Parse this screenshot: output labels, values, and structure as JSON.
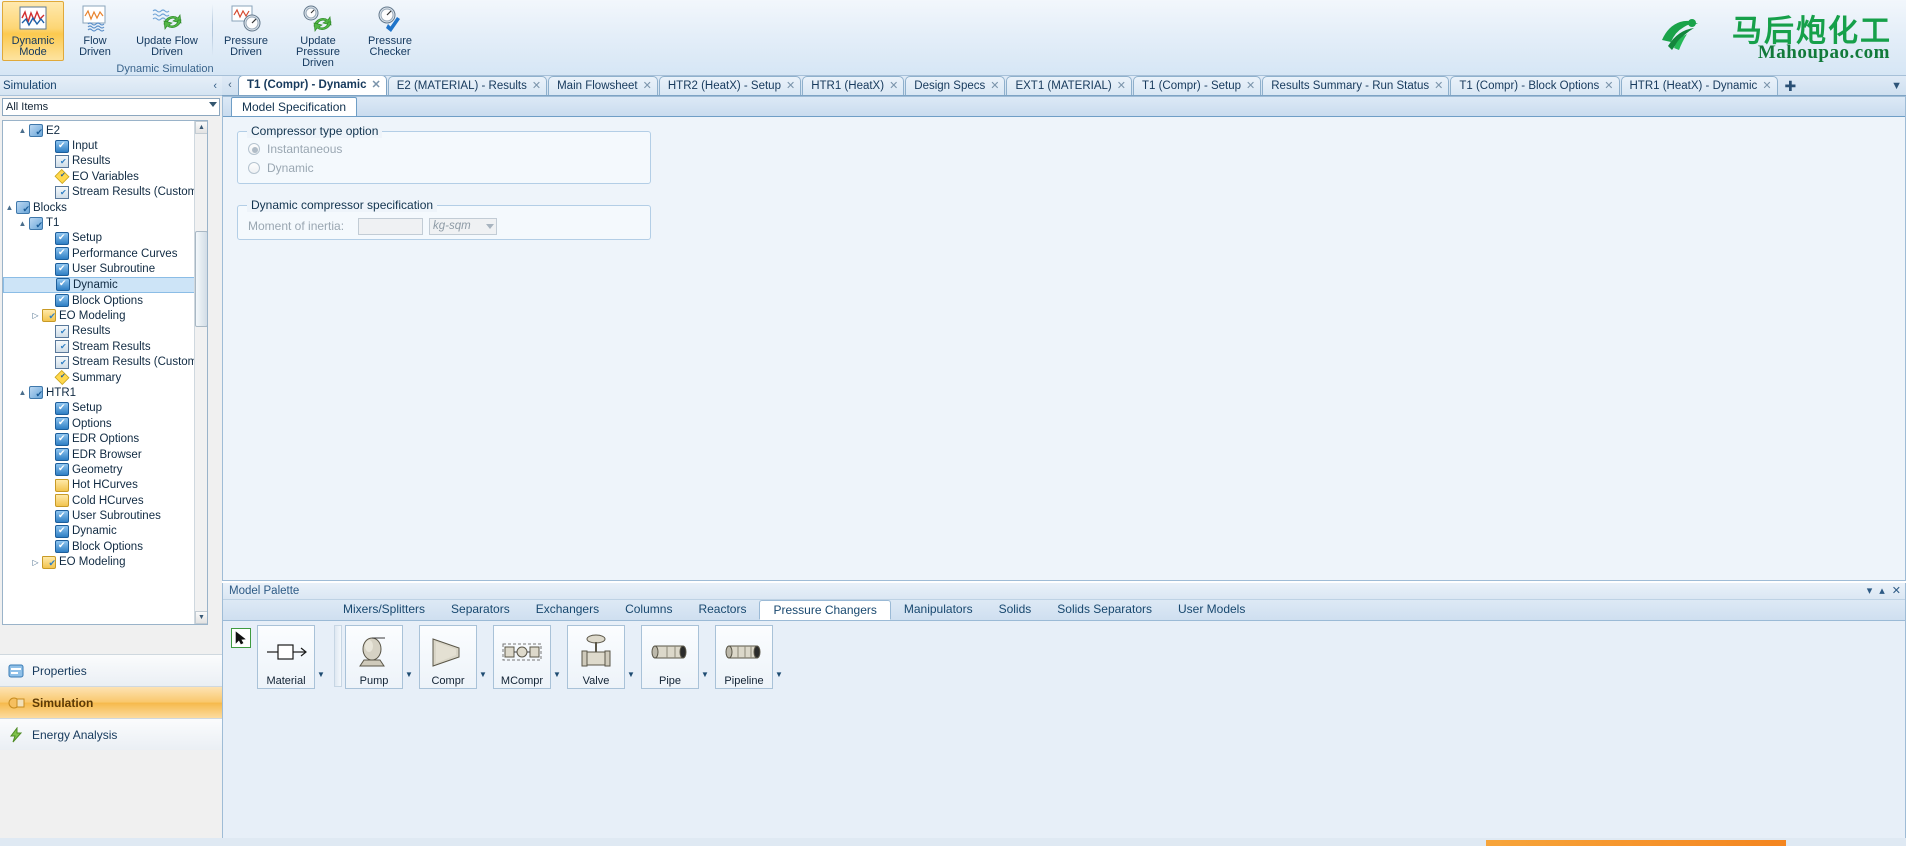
{
  "ribbon": {
    "buttons": [
      {
        "label": "Dynamic\nMode",
        "icon": "dynamic-mode-icon",
        "selected": true
      },
      {
        "label": "Flow\nDriven",
        "icon": "flow-driven-icon",
        "selected": false
      },
      {
        "label": "Update Flow\nDriven",
        "icon": "update-flow-driven-icon",
        "selected": false
      },
      {
        "label": "Pressure\nDriven",
        "icon": "pressure-driven-icon",
        "selected": false
      },
      {
        "label": "Update Pressure\nDriven",
        "icon": "update-pressure-driven-icon",
        "selected": false
      },
      {
        "label": "Pressure\nChecker",
        "icon": "pressure-checker-icon",
        "selected": false
      }
    ],
    "group_label": "Dynamic Simulation"
  },
  "logo": {
    "chinese": "马后炮化工",
    "english": "Mahoupao.com"
  },
  "doc_tabs": [
    {
      "label": "T1 (Compr) - Dynamic",
      "active": true
    },
    {
      "label": "E2 (MATERIAL) - Results",
      "active": false
    },
    {
      "label": "Main Flowsheet",
      "active": false
    },
    {
      "label": "HTR2 (HeatX) - Setup",
      "active": false
    },
    {
      "label": "HTR1 (HeatX)",
      "active": false
    },
    {
      "label": "Design Specs",
      "active": false
    },
    {
      "label": "EXT1 (MATERIAL)",
      "active": false
    },
    {
      "label": "T1 (Compr) - Setup",
      "active": false
    },
    {
      "label": "Results Summary - Run Status",
      "active": false
    },
    {
      "label": "T1 (Compr) - Block Options",
      "active": false
    },
    {
      "label": "HTR1 (HeatX) - Dynamic",
      "active": false
    }
  ],
  "tab_close_glyph": "✕",
  "tab_add_glyph": "✚",
  "tab_prev_glyph": "‹",
  "tab_dropdown_glyph": "▼",
  "sidebar": {
    "title": "Simulation",
    "collapse_glyph": "‹",
    "filter_value": "All Items",
    "tree": [
      {
        "label": "E2",
        "indent": 1,
        "icon": "blocks-icon",
        "twisty": "▲",
        "selected": false
      },
      {
        "label": "Input",
        "indent": 3,
        "icon": "form-icon",
        "twisty": "",
        "selected": false
      },
      {
        "label": "Results",
        "indent": 3,
        "icon": "sheet-icon",
        "twisty": "",
        "selected": false
      },
      {
        "label": "EO Variables",
        "indent": 3,
        "icon": "diamond-icon",
        "twisty": "",
        "selected": false
      },
      {
        "label": "Stream Results (Custom)",
        "indent": 3,
        "icon": "sheet-icon",
        "twisty": "",
        "selected": false
      },
      {
        "label": "Blocks",
        "indent": 0,
        "icon": "blocks-icon",
        "twisty": "▲",
        "selected": false
      },
      {
        "label": "T1",
        "indent": 1,
        "icon": "blocks-icon",
        "twisty": "▲",
        "selected": false
      },
      {
        "label": "Setup",
        "indent": 3,
        "icon": "form-icon",
        "twisty": "",
        "selected": false
      },
      {
        "label": "Performance Curves",
        "indent": 3,
        "icon": "form-icon",
        "twisty": "",
        "selected": false
      },
      {
        "label": "User Subroutine",
        "indent": 3,
        "icon": "form-icon",
        "twisty": "",
        "selected": false
      },
      {
        "label": "Dynamic",
        "indent": 3,
        "icon": "form-icon",
        "twisty": "",
        "selected": true
      },
      {
        "label": "Block Options",
        "indent": 3,
        "icon": "form-icon",
        "twisty": "",
        "selected": false
      },
      {
        "label": "EO Modeling",
        "indent": 2,
        "icon": "folder-chk-icon",
        "twisty": "▷",
        "selected": false
      },
      {
        "label": "Results",
        "indent": 3,
        "icon": "sheet-icon",
        "twisty": "",
        "selected": false
      },
      {
        "label": "Stream Results",
        "indent": 3,
        "icon": "sheet-icon",
        "twisty": "",
        "selected": false
      },
      {
        "label": "Stream Results (Custom)",
        "indent": 3,
        "icon": "sheet-icon",
        "twisty": "",
        "selected": false
      },
      {
        "label": "Summary",
        "indent": 3,
        "icon": "diamond-icon",
        "twisty": "",
        "selected": false
      },
      {
        "label": "HTR1",
        "indent": 1,
        "icon": "blocks-icon",
        "twisty": "▲",
        "selected": false
      },
      {
        "label": "Setup",
        "indent": 3,
        "icon": "form-icon",
        "twisty": "",
        "selected": false
      },
      {
        "label": "Options",
        "indent": 3,
        "icon": "form-icon",
        "twisty": "",
        "selected": false
      },
      {
        "label": "EDR Options",
        "indent": 3,
        "icon": "form-icon",
        "twisty": "",
        "selected": false
      },
      {
        "label": "EDR Browser",
        "indent": 3,
        "icon": "form-icon",
        "twisty": "",
        "selected": false
      },
      {
        "label": "Geometry",
        "indent": 3,
        "icon": "form-icon",
        "twisty": "",
        "selected": false
      },
      {
        "label": "Hot HCurves",
        "indent": 3,
        "icon": "folder-icon",
        "twisty": "",
        "selected": false
      },
      {
        "label": "Cold HCurves",
        "indent": 3,
        "icon": "folder-icon",
        "twisty": "",
        "selected": false
      },
      {
        "label": "User Subroutines",
        "indent": 3,
        "icon": "form-icon",
        "twisty": "",
        "selected": false
      },
      {
        "label": "Dynamic",
        "indent": 3,
        "icon": "form-icon",
        "twisty": "",
        "selected": false
      },
      {
        "label": "Block Options",
        "indent": 3,
        "icon": "form-icon",
        "twisty": "",
        "selected": false
      },
      {
        "label": "EO Modeling",
        "indent": 2,
        "icon": "folder-chk-icon",
        "twisty": "▷",
        "selected": false
      }
    ],
    "nav_buttons": [
      {
        "label": "Properties",
        "icon": "properties-icon",
        "active": false
      },
      {
        "label": "Simulation",
        "icon": "simulation-icon",
        "active": true
      },
      {
        "label": "Energy Analysis",
        "icon": "energy-analysis-icon",
        "active": false
      }
    ]
  },
  "main": {
    "inner_tabs": [
      {
        "label": "Model Specification",
        "active": true
      }
    ],
    "compressor_group": {
      "title": "Compressor type option",
      "options": [
        {
          "label": "Instantaneous",
          "checked": true
        },
        {
          "label": "Dynamic",
          "checked": false
        }
      ]
    },
    "dynamic_group": {
      "title": "Dynamic compressor specification",
      "field_label": "Moment of inertia:",
      "field_value": "",
      "units_value": "kg-sqm"
    }
  },
  "palette": {
    "title": "Model Palette",
    "win_buttons": [
      "▾",
      "▴",
      "✕"
    ],
    "tabs": [
      {
        "label": "Mixers/Splitters",
        "active": false
      },
      {
        "label": "Separators",
        "active": false
      },
      {
        "label": "Exchangers",
        "active": false
      },
      {
        "label": "Columns",
        "active": false
      },
      {
        "label": "Reactors",
        "active": false
      },
      {
        "label": "Pressure Changers",
        "active": true
      },
      {
        "label": "Manipulators",
        "active": false
      },
      {
        "label": "Solids",
        "active": false
      },
      {
        "label": "Solids Separators",
        "active": false
      },
      {
        "label": "User Models",
        "active": false
      }
    ],
    "pointer_tool": "▲",
    "items": [
      {
        "label": "Material",
        "icon": "material-stream-icon"
      },
      {
        "label": "Pump",
        "icon": "pump-icon"
      },
      {
        "label": "Compr",
        "icon": "compressor-icon"
      },
      {
        "label": "MCompr",
        "icon": "multistage-compressor-icon"
      },
      {
        "label": "Valve",
        "icon": "valve-icon"
      },
      {
        "label": "Pipe",
        "icon": "pipe-icon"
      },
      {
        "label": "Pipeline",
        "icon": "pipeline-icon"
      }
    ],
    "dropdown_glyph": "▼"
  },
  "colors": {
    "accent": "#f4851f",
    "selection": "#cde4f7",
    "panel": "#eef4fa",
    "logo_green": "#16a04a"
  }
}
